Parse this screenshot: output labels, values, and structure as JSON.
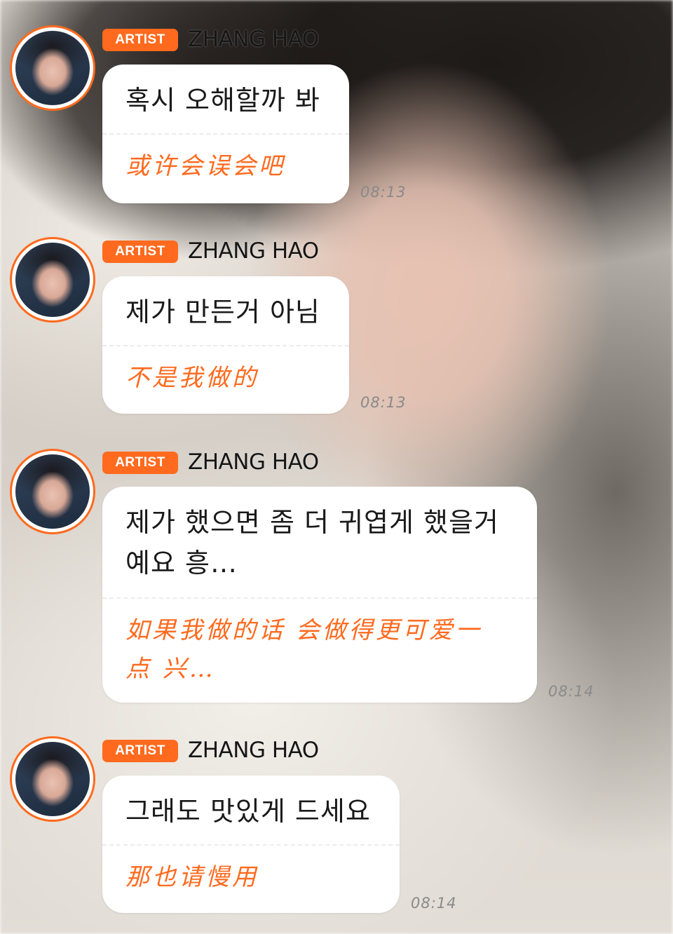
{
  "chat": {
    "messages": [
      {
        "badge": "ARTIST",
        "sender": "ZHANG HAO",
        "korean": "혹시 오해할까 봐",
        "chinese": "或许会误会吧",
        "time": "08:13"
      },
      {
        "badge": "ARTIST",
        "sender": "ZHANG HAO",
        "korean": "제가 만든거 아님",
        "chinese": "不是我做的",
        "time": "08:13"
      },
      {
        "badge": "ARTIST",
        "sender": "ZHANG HAO",
        "korean_line1": "제가 했으면 좀 더 귀엽게 했을거",
        "korean_line2": "예요 흥…",
        "chinese_line1": "如果我做的话 会做得更可爱一",
        "chinese_line2": "点 兴…",
        "time": "08:14"
      },
      {
        "badge": "ARTIST",
        "sender": "ZHANG HAO",
        "korean": "그래도 맛있게 드세요",
        "chinese": "那也请慢用",
        "time": "08:14"
      }
    ]
  },
  "colors": {
    "accent": "#ff6a1e",
    "bubble": "#ffffff",
    "timestamp": "#8a8a8a"
  },
  "icons": {
    "avatar": "profile-photo"
  }
}
